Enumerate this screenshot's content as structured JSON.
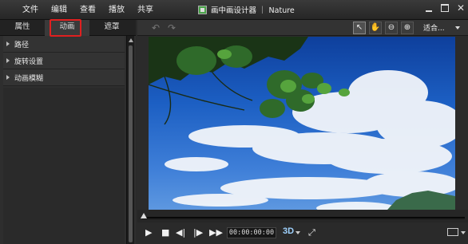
{
  "menu": [
    "文件",
    "编辑",
    "查看",
    "播放",
    "共享"
  ],
  "window_title": "画中画设计器 ｜ Nature",
  "tabs": [
    "属性",
    "动画",
    "遮罩"
  ],
  "active_tab": "动画",
  "properties": [
    "路径",
    "旋转设置",
    "动画模糊"
  ],
  "toolbar": {
    "zoom_label": "适合..."
  },
  "player": {
    "timecode": "00:00:00:00",
    "mode_3d": "3D"
  },
  "colors": {
    "highlight_box": "#e02020",
    "sky_top": "#0e3f9c",
    "sky_bottom": "#6aa2e3"
  }
}
